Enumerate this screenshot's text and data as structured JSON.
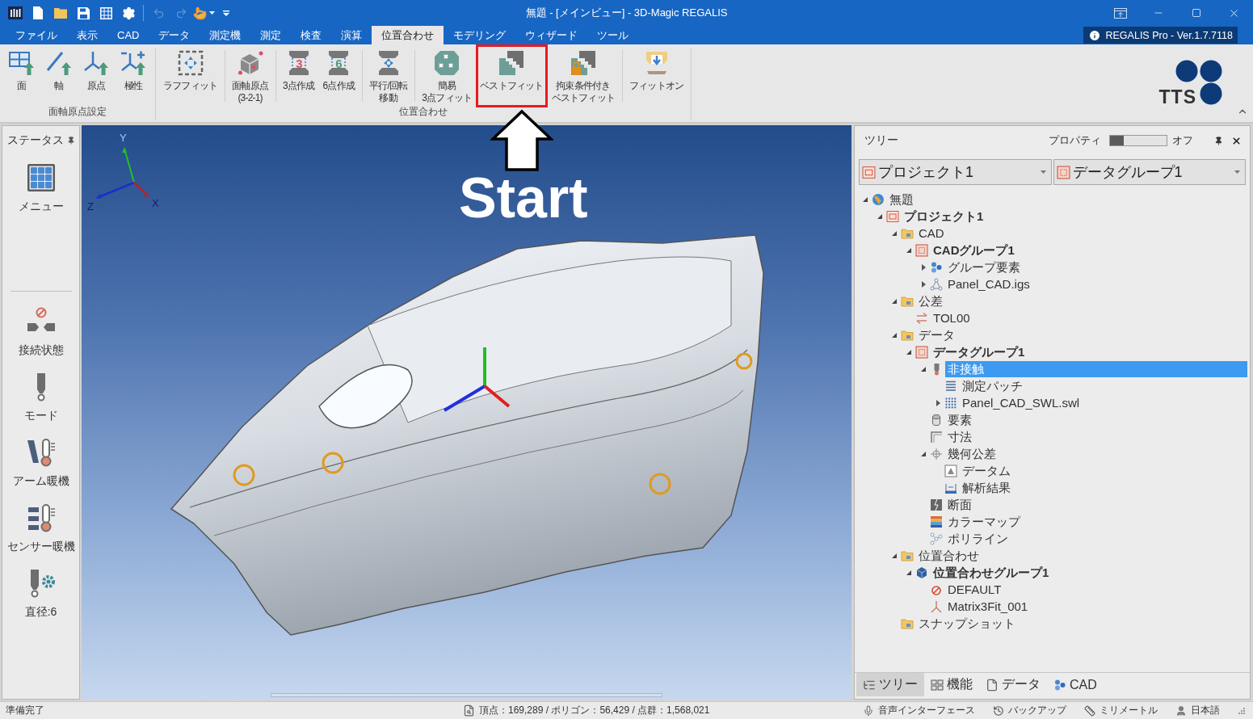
{
  "window": {
    "title": "無題 - [メインビュー] - 3D-Magic REGALIS"
  },
  "quick_access": [
    {
      "kind": "app",
      "disabled": false
    },
    {
      "kind": "new",
      "disabled": false
    },
    {
      "kind": "open",
      "disabled": false
    },
    {
      "kind": "save",
      "disabled": false
    },
    {
      "kind": "grid",
      "disabled": false
    },
    {
      "kind": "settings",
      "disabled": false
    },
    {
      "kind": "undo",
      "disabled": true
    },
    {
      "kind": "redo",
      "disabled": true
    },
    {
      "kind": "touch",
      "disabled": false
    },
    {
      "kind": "customize",
      "disabled": false
    }
  ],
  "tabs": [
    {
      "label": "ファイル",
      "selected": false
    },
    {
      "label": "表示",
      "selected": false
    },
    {
      "label": "CAD",
      "selected": false
    },
    {
      "label": "データ",
      "selected": false
    },
    {
      "label": "測定機",
      "selected": false
    },
    {
      "label": "測定",
      "selected": false
    },
    {
      "label": "検査",
      "selected": false
    },
    {
      "label": "演算",
      "selected": false
    },
    {
      "label": "位置合わせ",
      "selected": true
    },
    {
      "label": "モデリング",
      "selected": false
    },
    {
      "label": "ウィザード",
      "selected": false
    },
    {
      "label": "ツール",
      "selected": false
    }
  ],
  "version_badge": "REGALIS Pro - Ver.1.7.7118",
  "ribbon": {
    "groups": [
      {
        "label": "面軸原点設定",
        "sections": [
          {
            "buttons": [
              {
                "lines": [
                  "面"
                ],
                "kind": "plane",
                "highlighted": false
              },
              {
                "lines": [
                  "軸"
                ],
                "kind": "axis",
                "highlighted": false
              },
              {
                "lines": [
                  "原点"
                ],
                "kind": "origin",
                "highlighted": false
              },
              {
                "lines": [
                  "極性"
                ],
                "kind": "polarity",
                "highlighted": false
              }
            ]
          }
        ]
      },
      {
        "label": "位置合わせ",
        "sections": [
          {
            "buttons": [
              {
                "lines": [
                  "ラフフィット"
                ],
                "kind": "rough-fit",
                "highlighted": false
              }
            ]
          },
          {
            "buttons": [
              {
                "lines": [
                  "面軸原点",
                  "(3-2-1)"
                ],
                "kind": "cube",
                "highlighted": false
              }
            ]
          },
          {
            "buttons": [
              {
                "lines": [
                  "3点作成"
                ],
                "kind": "clamp",
                "glyph": "3",
                "color": "#d9506a",
                "highlighted": false
              },
              {
                "lines": [
                  "6点作成"
                ],
                "kind": "clamp",
                "glyph": "6",
                "color": "#4a9a80",
                "highlighted": false
              }
            ]
          },
          {
            "buttons": [
              {
                "lines": [
                  "平行/回転",
                  "移動"
                ],
                "kind": "move",
                "highlighted": false
              }
            ]
          },
          {
            "buttons": [
              {
                "lines": [
                  "簡易",
                  "3点フィット"
                ],
                "kind": "simple-fit",
                "highlighted": false
              },
              {
                "lines": [
                  "ベストフィット"
                ],
                "kind": "best-fit",
                "highlighted": true
              },
              {
                "lines": [
                  "拘束条件付き",
                  "ベストフィット"
                ],
                "kind": "constrained-fit",
                "highlighted": false
              }
            ]
          },
          {
            "buttons": [
              {
                "lines": [
                  "フィットオン"
                ],
                "kind": "fit-on",
                "highlighted": false
              }
            ]
          }
        ]
      }
    ],
    "logo_text": "TTS"
  },
  "status_panel": {
    "title": "ステータス",
    "sections": [
      {
        "items": [
          {
            "label": "メニュー",
            "kind": "menu"
          }
        ]
      },
      {
        "items": [
          {
            "label": "接続状態",
            "kind": "connection"
          },
          {
            "label": "モード",
            "kind": "mode"
          },
          {
            "label": "アーム暖機",
            "kind": "arm-warmup"
          },
          {
            "label": "センサー暖機",
            "kind": "sensor-warmup"
          },
          {
            "label": "直径:6",
            "kind": "diameter"
          }
        ]
      }
    ]
  },
  "viewport": {
    "axis_labels": {
      "y": "Y",
      "z": "Z",
      "x": "X"
    }
  },
  "annotation": {
    "text": "Start"
  },
  "tree_panel": {
    "title": "ツリー",
    "property": {
      "label": "プロパティ",
      "on": false,
      "state_text": "オフ"
    },
    "selectors": [
      {
        "value": "プロジェクト1",
        "kind": "project"
      },
      {
        "value": "データグループ1",
        "kind": "group"
      }
    ],
    "tree": [
      {
        "label": "無題",
        "kind": "document",
        "expanded": true,
        "selected": false,
        "children": [
          {
            "label": "プロジェクト1",
            "kind": "project",
            "expanded": true,
            "selected": false,
            "children": [
              {
                "label": "CAD",
                "kind": "folder",
                "expanded": true,
                "selected": false,
                "children": [
                  {
                    "label": "CADグループ1",
                    "kind": "group",
                    "expanded": true,
                    "selected": false,
                    "children": [
                      {
                        "label": "グループ要素",
                        "kind": "elements",
                        "expanded": false,
                        "selected": false
                      },
                      {
                        "label": "Panel_CAD.igs",
                        "kind": "mesh",
                        "expanded": false,
                        "selected": false
                      }
                    ]
                  }
                ]
              },
              {
                "label": "公差",
                "kind": "folder",
                "expanded": true,
                "selected": false,
                "children": [
                  {
                    "label": "TOL00",
                    "kind": "tolerance",
                    "selected": false
                  }
                ]
              },
              {
                "label": "データ",
                "kind": "folder",
                "expanded": true,
                "selected": false,
                "children": [
                  {
                    "label": "データグループ1",
                    "kind": "group",
                    "expanded": true,
                    "selected": false,
                    "children": [
                      {
                        "label": "非接触",
                        "kind": "probe",
                        "expanded": true,
                        "selected": true,
                        "children": [
                          {
                            "label": "測定パッチ",
                            "kind": "patch",
                            "selected": false
                          },
                          {
                            "label": "Panel_CAD_SWL.swl",
                            "kind": "pointcloud",
                            "expanded": false,
                            "selected": false
                          }
                        ]
                      },
                      {
                        "label": "要素",
                        "kind": "element",
                        "selected": false
                      },
                      {
                        "label": "寸法",
                        "kind": "dimension",
                        "selected": false
                      },
                      {
                        "label": "幾何公差",
                        "kind": "gdt",
                        "expanded": true,
                        "selected": false,
                        "children": [
                          {
                            "label": "データム",
                            "kind": "datum",
                            "selected": false
                          },
                          {
                            "label": "解析結果",
                            "kind": "result",
                            "selected": false
                          }
                        ]
                      },
                      {
                        "label": "断面",
                        "kind": "section",
                        "selected": false
                      },
                      {
                        "label": "カラーマップ",
                        "kind": "colormap",
                        "selected": false
                      },
                      {
                        "label": "ポリライン",
                        "kind": "polyline",
                        "selected": false
                      }
                    ]
                  }
                ]
              },
              {
                "label": "位置合わせ",
                "kind": "folder",
                "expanded": true,
                "selected": false,
                "children": [
                  {
                    "label": "位置合わせグループ1",
                    "kind": "align-group",
                    "expanded": true,
                    "selected": false,
                    "children": [
                      {
                        "label": "DEFAULT",
                        "kind": "no-fit",
                        "selected": false
                      },
                      {
                        "label": "Matrix3Fit_001",
                        "kind": "axes",
                        "selected": false
                      }
                    ]
                  }
                ]
              },
              {
                "label": "スナップショット",
                "kind": "folder",
                "selected": false
              }
            ]
          }
        ]
      }
    ],
    "tabs": [
      {
        "label": "ツリー",
        "kind": "tree",
        "selected": true
      },
      {
        "label": "機能",
        "kind": "functions",
        "selected": false
      },
      {
        "label": "データ",
        "kind": "data",
        "selected": false
      },
      {
        "label": "CAD",
        "kind": "cad",
        "selected": false
      }
    ]
  },
  "status_bar": {
    "message": "準備完了",
    "stats": "頂点：169,289 / ポリゴン：56,429 / 点群：1,568,021",
    "items": [
      {
        "label": "音声インターフェース",
        "kind": "mic"
      },
      {
        "label": "バックアップ",
        "kind": "backup"
      },
      {
        "label": "ミリメートル",
        "kind": "unit"
      },
      {
        "label": "日本語",
        "kind": "language"
      }
    ]
  }
}
